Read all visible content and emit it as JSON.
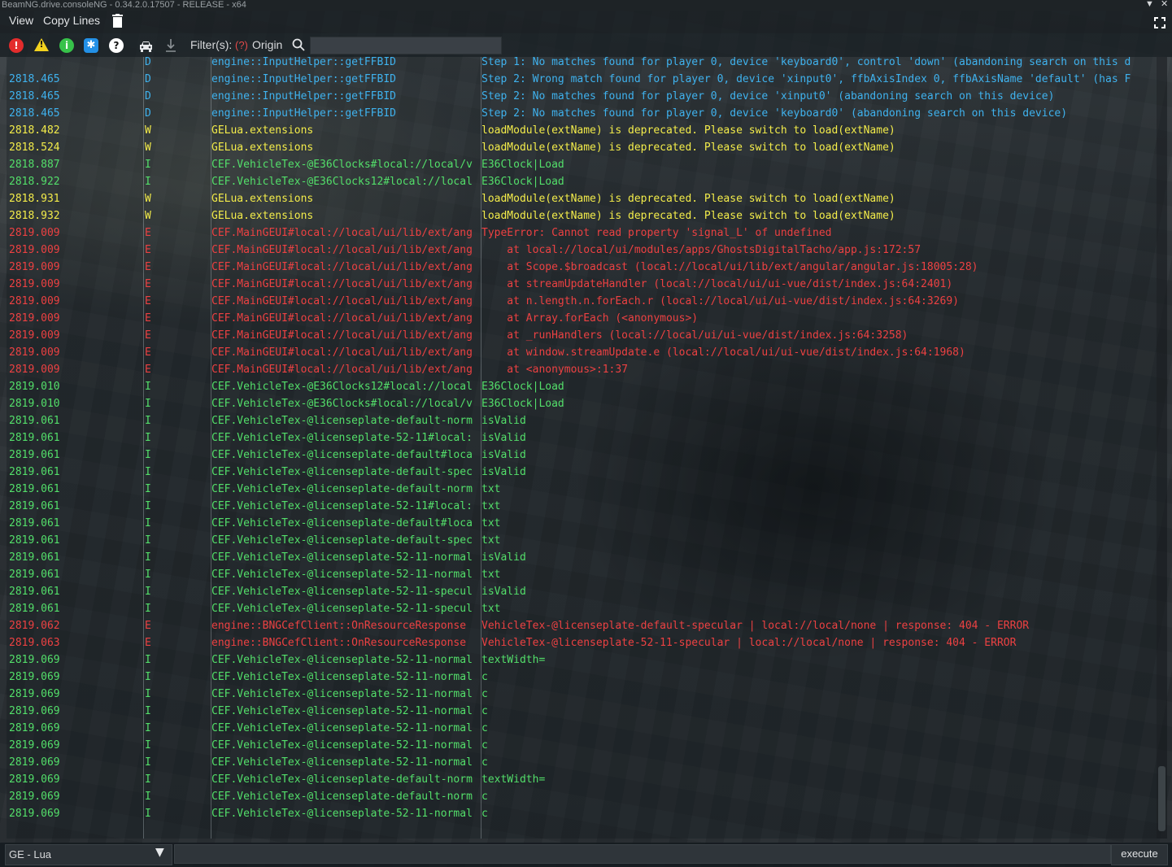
{
  "window": {
    "title": "BeamNG.drive.consoleNG - 0.34.2.0.17507 - RELEASE - x64",
    "collapse_glyph": "▼",
    "close_glyph": "✕"
  },
  "menu": {
    "view": "View",
    "copy_lines": "Copy Lines",
    "trash_icon": "trash-icon",
    "fullscreen_icon": "fullscreen-icon"
  },
  "toolbar": {
    "error_glyph": "!",
    "warning_glyph": "!",
    "info_glyph": "i",
    "debug_glyph": "✱",
    "help_glyph": "?",
    "car_icon": "car-icon",
    "download_icon": "download-icon",
    "filter_label": "Filter(s):",
    "filter_help": "(?)",
    "origin_label": "Origin",
    "search_icon": "search-icon",
    "search_value": ""
  },
  "colors": {
    "debug": "#3fb2ee",
    "warning": "#f3ec4a",
    "info": "#53df6a",
    "error": "#ec4142"
  },
  "log": [
    {
      "time": "",
      "level": "D",
      "origin": "engine::InputHelper::getFFBID",
      "message": "Step 1: No matches found for player 0, device 'keyboard0', control 'down' (abandoning search on this d"
    },
    {
      "time": "2818.465",
      "level": "D",
      "origin": "engine::InputHelper::getFFBID",
      "message": "Step 2: Wrong match found for player 0, device 'xinput0', ffbAxisIndex 0, ffbAxisName 'default' (has F"
    },
    {
      "time": "2818.465",
      "level": "D",
      "origin": "engine::InputHelper::getFFBID",
      "message": "Step 2: No matches found for player 0, device 'xinput0' (abandoning search on this device)"
    },
    {
      "time": "2818.465",
      "level": "D",
      "origin": "engine::InputHelper::getFFBID",
      "message": "Step 2: No matches found for player 0, device 'keyboard0' (abandoning search on this device)"
    },
    {
      "time": "2818.482",
      "level": "W",
      "origin": "GELua.extensions",
      "message": "loadModule(extName) is deprecated. Please switch to load(extName)"
    },
    {
      "time": "2818.524",
      "level": "W",
      "origin": "GELua.extensions",
      "message": "loadModule(extName) is deprecated. Please switch to load(extName)"
    },
    {
      "time": "2818.887",
      "level": "I",
      "origin": "CEF.VehicleTex-@E36Clocks#local://local/v",
      "message": "E36Clock|Load"
    },
    {
      "time": "2818.922",
      "level": "I",
      "origin": "CEF.VehicleTex-@E36Clocks12#local://local",
      "message": "E36Clock|Load"
    },
    {
      "time": "2818.931",
      "level": "W",
      "origin": "GELua.extensions",
      "message": "loadModule(extName) is deprecated. Please switch to load(extName)"
    },
    {
      "time": "2818.932",
      "level": "W",
      "origin": "GELua.extensions",
      "message": "loadModule(extName) is deprecated. Please switch to load(extName)"
    },
    {
      "time": "2819.009",
      "level": "E",
      "origin": "CEF.MainGEUI#local://local/ui/lib/ext/ang",
      "message": "TypeError: Cannot read property 'signal_L' of undefined"
    },
    {
      "time": "2819.009",
      "level": "E",
      "origin": "CEF.MainGEUI#local://local/ui/lib/ext/ang",
      "message": "    at local://local/ui/modules/apps/GhostsDigitalTacho/app.js:172:57"
    },
    {
      "time": "2819.009",
      "level": "E",
      "origin": "CEF.MainGEUI#local://local/ui/lib/ext/ang",
      "message": "    at Scope.$broadcast (local://local/ui/lib/ext/angular/angular.js:18005:28)"
    },
    {
      "time": "2819.009",
      "level": "E",
      "origin": "CEF.MainGEUI#local://local/ui/lib/ext/ang",
      "message": "    at streamUpdateHandler (local://local/ui/ui-vue/dist/index.js:64:2401)"
    },
    {
      "time": "2819.009",
      "level": "E",
      "origin": "CEF.MainGEUI#local://local/ui/lib/ext/ang",
      "message": "    at n.length.n.forEach.r (local://local/ui/ui-vue/dist/index.js:64:3269)"
    },
    {
      "time": "2819.009",
      "level": "E",
      "origin": "CEF.MainGEUI#local://local/ui/lib/ext/ang",
      "message": "    at Array.forEach (<anonymous>)"
    },
    {
      "time": "2819.009",
      "level": "E",
      "origin": "CEF.MainGEUI#local://local/ui/lib/ext/ang",
      "message": "    at _runHandlers (local://local/ui/ui-vue/dist/index.js:64:3258)"
    },
    {
      "time": "2819.009",
      "level": "E",
      "origin": "CEF.MainGEUI#local://local/ui/lib/ext/ang",
      "message": "    at window.streamUpdate.e (local://local/ui/ui-vue/dist/index.js:64:1968)"
    },
    {
      "time": "2819.009",
      "level": "E",
      "origin": "CEF.MainGEUI#local://local/ui/lib/ext/ang",
      "message": "    at <anonymous>:1:37"
    },
    {
      "time": "2819.010",
      "level": "I",
      "origin": "CEF.VehicleTex-@E36Clocks12#local://local",
      "message": "E36Clock|Load"
    },
    {
      "time": "2819.010",
      "level": "I",
      "origin": "CEF.VehicleTex-@E36Clocks#local://local/v",
      "message": "E36Clock|Load"
    },
    {
      "time": "2819.061",
      "level": "I",
      "origin": "CEF.VehicleTex-@licenseplate-default-norm",
      "message": "isValid"
    },
    {
      "time": "2819.061",
      "level": "I",
      "origin": "CEF.VehicleTex-@licenseplate-52-11#local:",
      "message": "isValid"
    },
    {
      "time": "2819.061",
      "level": "I",
      "origin": "CEF.VehicleTex-@licenseplate-default#loca",
      "message": "isValid"
    },
    {
      "time": "2819.061",
      "level": "I",
      "origin": "CEF.VehicleTex-@licenseplate-default-spec",
      "message": "isValid"
    },
    {
      "time": "2819.061",
      "level": "I",
      "origin": "CEF.VehicleTex-@licenseplate-default-norm",
      "message": "txt"
    },
    {
      "time": "2819.061",
      "level": "I",
      "origin": "CEF.VehicleTex-@licenseplate-52-11#local:",
      "message": "txt"
    },
    {
      "time": "2819.061",
      "level": "I",
      "origin": "CEF.VehicleTex-@licenseplate-default#loca",
      "message": "txt"
    },
    {
      "time": "2819.061",
      "level": "I",
      "origin": "CEF.VehicleTex-@licenseplate-default-spec",
      "message": "txt"
    },
    {
      "time": "2819.061",
      "level": "I",
      "origin": "CEF.VehicleTex-@licenseplate-52-11-normal",
      "message": "isValid"
    },
    {
      "time": "2819.061",
      "level": "I",
      "origin": "CEF.VehicleTex-@licenseplate-52-11-normal",
      "message": "txt"
    },
    {
      "time": "2819.061",
      "level": "I",
      "origin": "CEF.VehicleTex-@licenseplate-52-11-specul",
      "message": "isValid"
    },
    {
      "time": "2819.061",
      "level": "I",
      "origin": "CEF.VehicleTex-@licenseplate-52-11-specul",
      "message": "txt"
    },
    {
      "time": "2819.062",
      "level": "E",
      "origin": "engine::BNGCefClient::OnResourceResponse",
      "message": "VehicleTex-@licenseplate-default-specular | local://local/none | response: 404 - ERROR"
    },
    {
      "time": "2819.063",
      "level": "E",
      "origin": "engine::BNGCefClient::OnResourceResponse",
      "message": "VehicleTex-@licenseplate-52-11-specular | local://local/none | response: 404 - ERROR"
    },
    {
      "time": "2819.069",
      "level": "I",
      "origin": "CEF.VehicleTex-@licenseplate-52-11-normal",
      "message": "textWidth="
    },
    {
      "time": "2819.069",
      "level": "I",
      "origin": "CEF.VehicleTex-@licenseplate-52-11-normal",
      "message": "c"
    },
    {
      "time": "2819.069",
      "level": "I",
      "origin": "CEF.VehicleTex-@licenseplate-52-11-normal",
      "message": "c"
    },
    {
      "time": "2819.069",
      "level": "I",
      "origin": "CEF.VehicleTex-@licenseplate-52-11-normal",
      "message": "c"
    },
    {
      "time": "2819.069",
      "level": "I",
      "origin": "CEF.VehicleTex-@licenseplate-52-11-normal",
      "message": "c"
    },
    {
      "time": "2819.069",
      "level": "I",
      "origin": "CEF.VehicleTex-@licenseplate-52-11-normal",
      "message": "c"
    },
    {
      "time": "2819.069",
      "level": "I",
      "origin": "CEF.VehicleTex-@licenseplate-52-11-normal",
      "message": "c"
    },
    {
      "time": "2819.069",
      "level": "I",
      "origin": "CEF.VehicleTex-@licenseplate-default-norm",
      "message": "textWidth="
    },
    {
      "time": "2819.069",
      "level": "I",
      "origin": "CEF.VehicleTex-@licenseplate-default-norm",
      "message": "c"
    },
    {
      "time": "2819.069",
      "level": "I",
      "origin": "CEF.VehicleTex-@licenseplate-52-11-normal",
      "message": "c"
    }
  ],
  "bottom": {
    "context": "GE - Lua",
    "dropdown_glyph": "▼",
    "command_value": "",
    "execute": "execute"
  }
}
